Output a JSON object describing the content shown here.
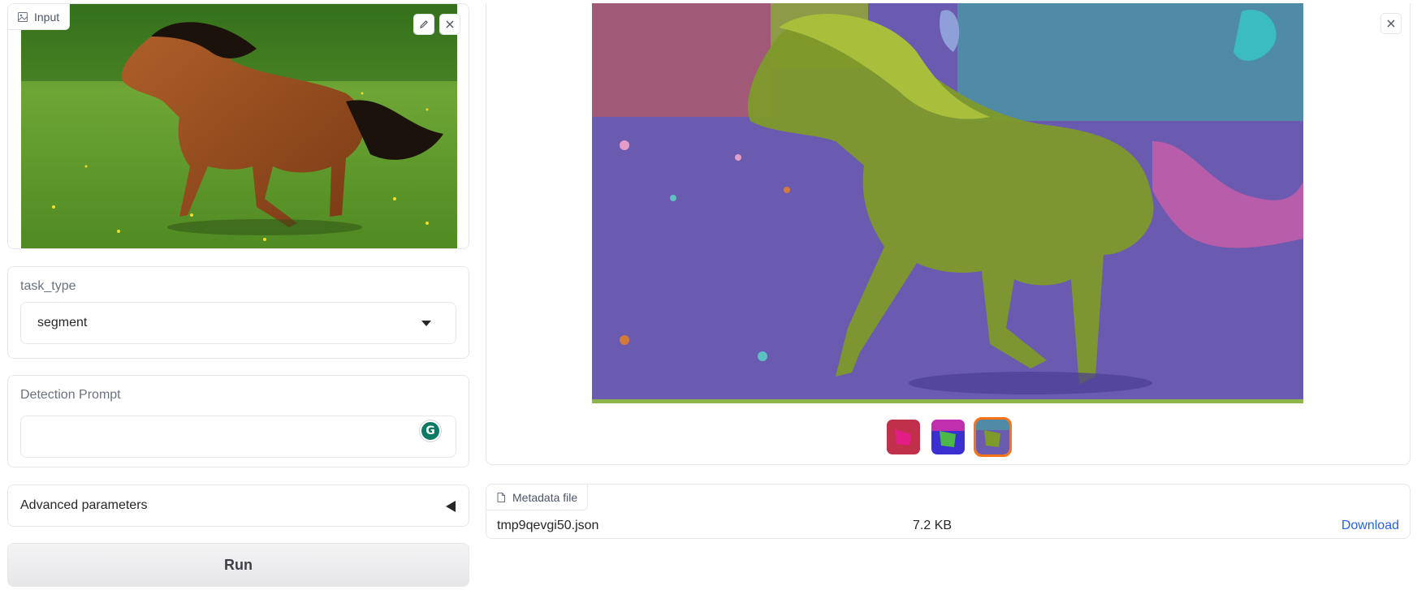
{
  "input": {
    "label": "Input",
    "icons": [
      "image-icon",
      "pencil-icon",
      "close-icon"
    ]
  },
  "task_type": {
    "label": "task_type",
    "value": "segment"
  },
  "prompt": {
    "label": "Detection Prompt",
    "value": "",
    "grammarly_icon": "G"
  },
  "advanced": {
    "label": "Advanced parameters"
  },
  "run": {
    "label": "Run"
  },
  "gallery": {
    "thumbnails": 3,
    "selected_index": 2
  },
  "file": {
    "label": "Metadata file",
    "name": "tmp9qevgi50.json",
    "size": "7.2 KB",
    "link": "Download"
  },
  "colors": {
    "accent": "#f97316",
    "link": "#2563eb"
  }
}
